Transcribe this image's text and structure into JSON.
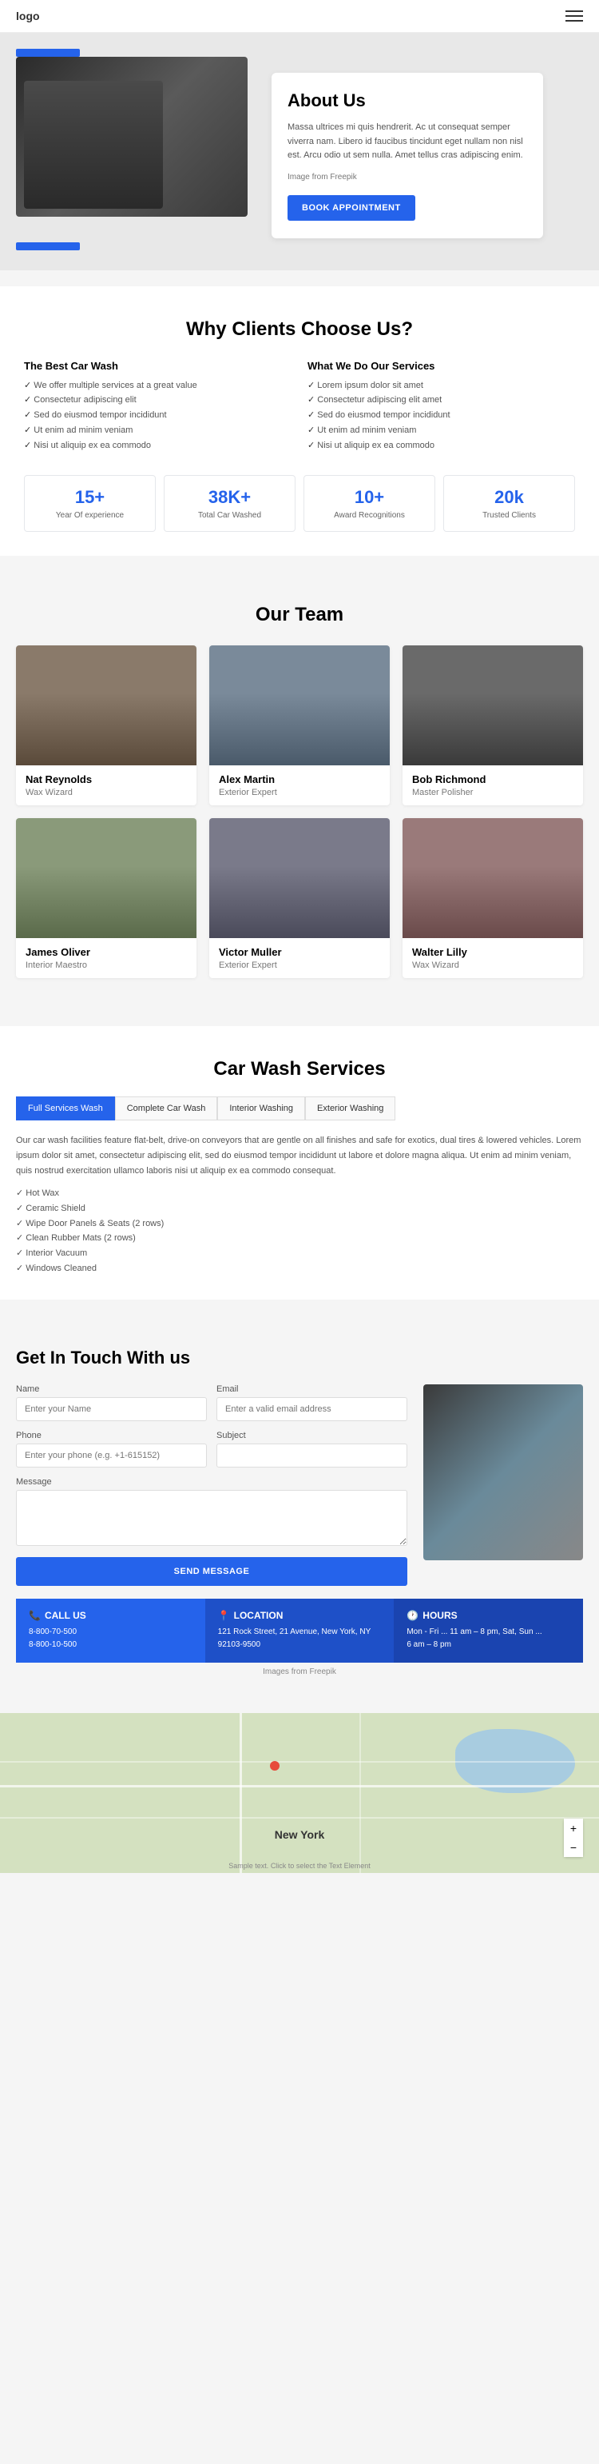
{
  "header": {
    "logo": "logo",
    "menu_icon": "≡"
  },
  "hero": {
    "title": "About Us",
    "description": "Massa ultrices mi quis hendrerit. Ac ut consequat semper viverra nam. Libero id faucibus tincidunt eget nullam non nisl est. Arcu odio ut sem nulla. Amet tellus cras adipiscing enim.",
    "image_credit": "Image from Freepik",
    "book_btn": "BOOK APPOINTMENT"
  },
  "why": {
    "title": "Why Clients Choose Us?",
    "col1_title": "The Best Car Wash",
    "col1_items": [
      "We offer multiple services at a great value",
      "Consectetur adipiscing elit",
      "Sed do eiusmod tempor incididunt",
      "Ut enim ad minim veniam",
      "Nisi ut aliquip ex ea commodo"
    ],
    "col2_title": "What We Do Our Services",
    "col2_items": [
      "Lorem ipsum dolor sit amet",
      "Consectetur adipiscing elit amet",
      "Sed do eiusmod tempor incididunt",
      "Ut enim ad minim veniam",
      "Nisi ut aliquip ex ea commodo"
    ],
    "stats": [
      {
        "number": "15+",
        "label": "Year Of experience"
      },
      {
        "number": "38K+",
        "label": "Total Car Washed"
      },
      {
        "number": "10+",
        "label": "Award Recognitions"
      },
      {
        "number": "20k",
        "label": "Trusted Clients"
      }
    ]
  },
  "team": {
    "title": "Our Team",
    "members": [
      {
        "name": "Nat Reynolds",
        "role": "Wax Wizard",
        "photo_class": "p1"
      },
      {
        "name": "Alex Martin",
        "role": "Exterior Expert",
        "photo_class": "p2"
      },
      {
        "name": "Bob Richmond",
        "role": "Master Polisher",
        "photo_class": "p3"
      },
      {
        "name": "James Oliver",
        "role": "Interior Maestro",
        "photo_class": "p4"
      },
      {
        "name": "Victor Muller",
        "role": "Exterior Expert",
        "photo_class": "p5"
      },
      {
        "name": "Walter Lilly",
        "role": "Wax Wizard",
        "photo_class": "p6"
      }
    ]
  },
  "services": {
    "title": "Car Wash Services",
    "tabs": [
      "Full Services Wash",
      "Complete Car Wash",
      "Interior Washing",
      "Exterior Washing"
    ],
    "active_tab": 0,
    "description": "Our car wash facilities feature flat-belt, drive-on conveyors that are gentle on all finishes and safe for exotics, dual tires & lowered vehicles. Lorem ipsum dolor sit amet, consectetur adipiscing elit, sed do eiusmod tempor incididunt ut labore et dolore magna aliqua. Ut enim ad minim veniam, quis nostrud exercitation ullamco laboris nisi ut aliquip ex ea commodo consequat.",
    "items": [
      "Hot Wax",
      "Ceramic Shield",
      "Wipe Door Panels & Seats (2 rows)",
      "Clean Rubber Mats (2 rows)",
      "Interior Vacuum",
      "Windows Cleaned"
    ]
  },
  "contact": {
    "title": "Get In Touch With us",
    "fields": {
      "name_label": "Name",
      "name_placeholder": "Enter your Name",
      "email_label": "Email",
      "email_placeholder": "Enter a valid email address",
      "phone_label": "Phone",
      "phone_placeholder": "Enter your phone (e.g. +1-615152)",
      "subject_label": "Subject",
      "subject_placeholder": "",
      "message_label": "Message",
      "message_placeholder": ""
    },
    "send_btn": "SEND MESSAGE"
  },
  "info_boxes": [
    {
      "icon": "📞",
      "title": "CALL US",
      "lines": [
        "8-800-70-500",
        "8-800-10-500"
      ],
      "color_class": "blue"
    },
    {
      "icon": "📍",
      "title": "LOCATION",
      "lines": [
        "121 Rock Street, 21 Avenue, New York, NY",
        "92103-9500"
      ],
      "color_class": "mid"
    },
    {
      "icon": "🕐",
      "title": "HOURS",
      "lines": [
        "Mon - Fri ... 11 am – 8 pm, Sat, Sun ...",
        "6 am – 8 pm"
      ],
      "color_class": "dark"
    }
  ],
  "freepik_note": "Images from Freepik",
  "map": {
    "label": "New York",
    "attribution": "Sample text. Click to select the Text Element"
  }
}
